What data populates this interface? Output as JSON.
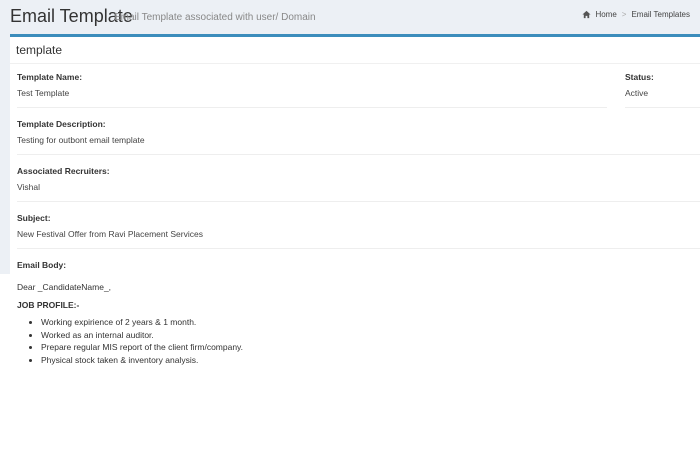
{
  "header": {
    "title": "Email Template",
    "subtitle": "Email Template associated with user/ Domain",
    "breadcrumb": {
      "home": "Home",
      "current": "Email Templates"
    }
  },
  "panel": {
    "title": "template",
    "template_name_label": "Template Name:",
    "template_name_value": "Test Template",
    "status_label": "Status:",
    "status_value": "Active",
    "description_label": "Template Description:",
    "description_value": "Testing for outbont email template",
    "recruiters_label": "Associated Recruiters:",
    "recruiters_value": "Vishal",
    "subject_label": "Subject:",
    "subject_value": "New Festival Offer from Ravi Placement Services",
    "email_body_label": "Email Body:"
  },
  "email_body": {
    "greeting": "Dear _CandidateName_,",
    "job_profile_heading": "JOB PROFILE:-",
    "items": [
      "Working expirience of 2 years & 1 month.",
      "Worked as an internal auditor.",
      "Prepare regular MIS report of the client firm/company.",
      "Physical stock taken & inventory analysis."
    ]
  },
  "colors": {
    "accent": "#3c8dbc",
    "header_bg": "#ecf0f5"
  },
  "icons": {
    "home": "home-icon"
  }
}
